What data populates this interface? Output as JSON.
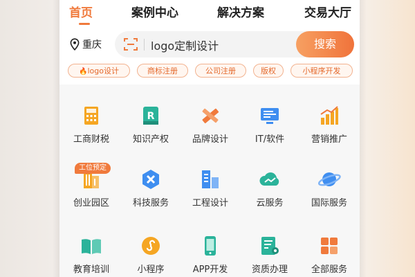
{
  "nav": {
    "tabs": [
      {
        "label": "首页",
        "active": true
      },
      {
        "label": "案例中心"
      },
      {
        "label": "解决方案"
      },
      {
        "label": "交易大厅"
      }
    ]
  },
  "location": {
    "city": "重庆"
  },
  "search": {
    "value": "logo定制设计",
    "button_label": "搜索"
  },
  "hot_tags": [
    "logo设计",
    "商标注册",
    "公司注册",
    "版权",
    "小程序开发"
  ],
  "services": [
    {
      "label": "工商财税",
      "icon": "tax-calculator-icon"
    },
    {
      "label": "知识产权",
      "icon": "ip-register-icon"
    },
    {
      "label": "品牌设计",
      "icon": "brand-pen-ruler-icon"
    },
    {
      "label": "IT/软件",
      "icon": "software-monitor-icon"
    },
    {
      "label": "营销推广",
      "icon": "marketing-chart-icon"
    },
    {
      "label": "创业园区",
      "icon": "startup-park-icon",
      "badge": "工位预定"
    },
    {
      "label": "科技服务",
      "icon": "tech-service-icon"
    },
    {
      "label": "工程设计",
      "icon": "engineering-buildings-icon"
    },
    {
      "label": "云服务",
      "icon": "cloud-service-icon"
    },
    {
      "label": "国际服务",
      "icon": "planet-icon"
    },
    {
      "label": "教育培训",
      "icon": "open-book-icon"
    },
    {
      "label": "小程序",
      "icon": "mini-program-icon"
    },
    {
      "label": "APP开发",
      "icon": "mobile-phone-icon"
    },
    {
      "label": "资质办理",
      "icon": "certificate-icon"
    },
    {
      "label": "全部服务",
      "icon": "all-services-grid-icon"
    }
  ],
  "colors": {
    "accent": "#f07a3c",
    "tag_border": "#f2b28f",
    "tag_bg": "#fff6f0",
    "orange_icon": "#f5a623",
    "green_icon": "#2bb39a",
    "blue_icon": "#3f8ef0"
  }
}
